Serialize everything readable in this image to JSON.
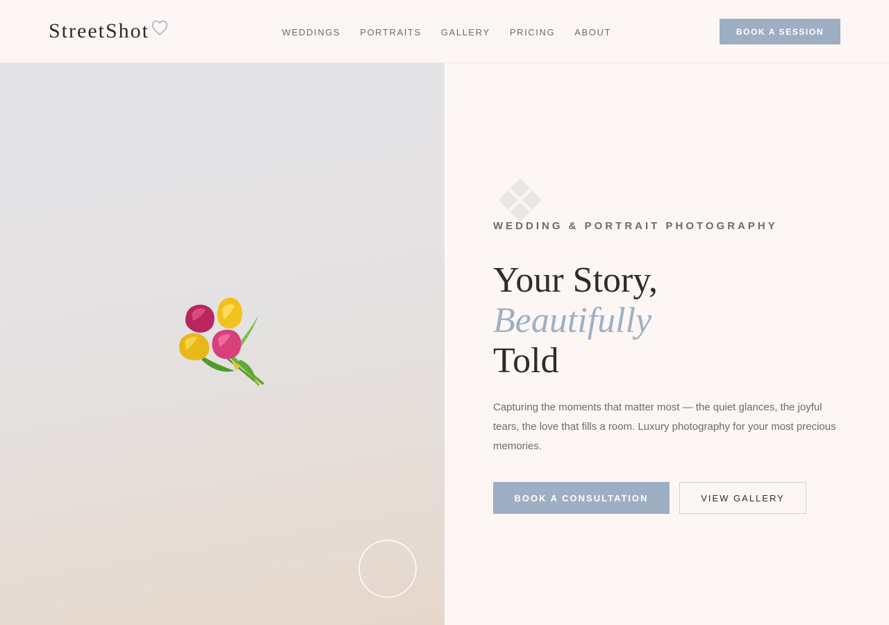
{
  "header": {
    "logo_text": "StreetShot",
    "logo_icon": "heart-outline-icon",
    "nav": [
      {
        "label": "WEDDINGS"
      },
      {
        "label": "PORTRAITS"
      },
      {
        "label": "GALLERY"
      },
      {
        "label": "PRICING"
      },
      {
        "label": "ABOUT"
      }
    ],
    "cta_label": "BOOK A SESSION"
  },
  "hero": {
    "image_icon": "bouquet-icon",
    "play_icon": "circle-outline",
    "decor_icon": "diamond-grid-icon",
    "eyebrow": "WEDDING & PORTRAIT PHOTOGRAPHY",
    "headline": {
      "line1": "Your Story,",
      "line2": "Beautifully",
      "line3": "Told"
    },
    "description": "Capturing the moments that matter most — the quiet glances, the joyful tears, the love that fills a room. Luxury photography for your most precious memories.",
    "primary_button": "BOOK A CONSULTATION",
    "secondary_button": "VIEW GALLERY"
  },
  "colors": {
    "background": "#fcf7f4",
    "accent": "#9fafc3",
    "text_dark": "#2f2b2b",
    "text_muted": "#6f6a6a"
  }
}
